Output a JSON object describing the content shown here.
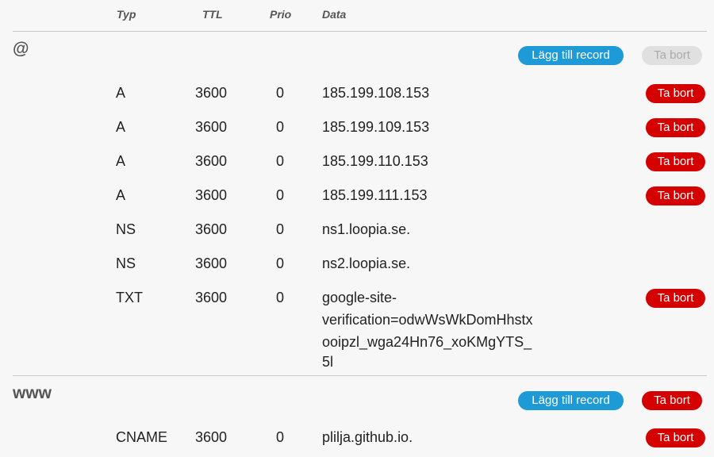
{
  "columns": {
    "typ": "Typ",
    "ttl": "TTL",
    "prio": "Prio",
    "data": "Data"
  },
  "groups": [
    {
      "name": "@",
      "add_label": "Lägg till record",
      "delete_label": "Ta bort",
      "delete_disabled": true,
      "records": [
        {
          "type": "A",
          "ttl": "3600",
          "prio": "0",
          "data": "185.199.108.153",
          "delete": "Ta bort"
        },
        {
          "type": "A",
          "ttl": "3600",
          "prio": "0",
          "data": "185.199.109.153",
          "delete": "Ta bort"
        },
        {
          "type": "A",
          "ttl": "3600",
          "prio": "0",
          "data": "185.199.110.153",
          "delete": "Ta bort"
        },
        {
          "type": "A",
          "ttl": "3600",
          "prio": "0",
          "data": "185.199.111.153",
          "delete": "Ta bort"
        },
        {
          "type": "NS",
          "ttl": "3600",
          "prio": "0",
          "data": "ns1.loopia.se.",
          "delete": ""
        },
        {
          "type": "NS",
          "ttl": "3600",
          "prio": "0",
          "data": "ns2.loopia.se.",
          "delete": ""
        },
        {
          "type": "TXT",
          "ttl": "3600",
          "prio": "0",
          "data_lines": [
            "google-site-",
            "verification=odwWsWkDomHhstx",
            "ooipzl_wga24Hn76_xoKMgYTS_",
            "5l"
          ],
          "delete": "Ta bort"
        }
      ]
    },
    {
      "name": "www",
      "add_label": "Lägg till record",
      "delete_label": "Ta bort",
      "delete_disabled": false,
      "records": [
        {
          "type": "CNAME",
          "ttl": "3600",
          "prio": "0",
          "data": "plilja.github.io.",
          "delete": "Ta bort"
        }
      ]
    }
  ],
  "colors": {
    "add_button": "#1e9ad6",
    "delete_button": "#d50000",
    "delete_disabled": "#e0e0e0"
  }
}
